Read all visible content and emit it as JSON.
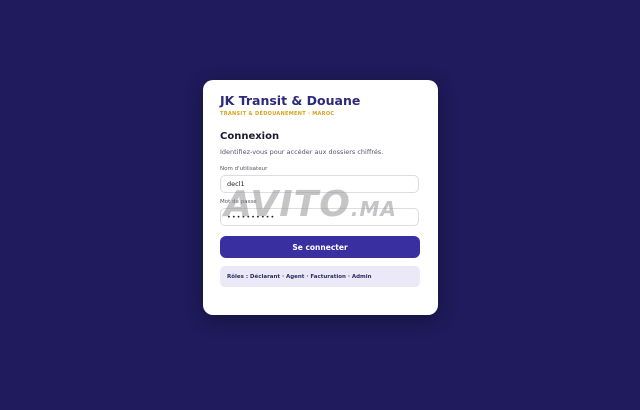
{
  "brand": {
    "title": "JK Transit & Douane",
    "subtitle": "TRANSIT & DÉDOUANEMENT · MAROC"
  },
  "login": {
    "title": "Connexion",
    "description": "Identifiez-vous pour accéder aux dossiers chiffrés.",
    "username_label": "Nom d'utilisateur",
    "username_value": "decl1",
    "password_label": "Mot de passe",
    "password_value": "••••••••••",
    "submit_label": "Se connecter",
    "roles_text": "Rôles : Déclarant · Agent · Facturation · Admin"
  },
  "watermark": {
    "main": "AVITO",
    "suffix": ".MA"
  },
  "colors": {
    "background": "#1f1b5c",
    "brand": "#2e2a7a",
    "accent": "#d9a21b",
    "button": "#3a2fa0"
  }
}
